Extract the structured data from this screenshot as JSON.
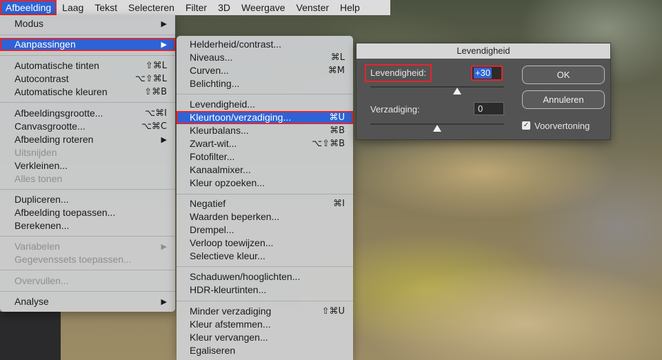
{
  "menubar": {
    "items": [
      "Afbeelding",
      "Laag",
      "Tekst",
      "Selecteren",
      "Filter",
      "3D",
      "Weergave",
      "Venster",
      "Help"
    ]
  },
  "image_menu": {
    "items": [
      {
        "label": "Modus",
        "submenu": true
      },
      {
        "label": "Aanpassingen",
        "submenu": true,
        "highlighted": true
      },
      {
        "label": "Automatische tinten",
        "shortcut": "⇧⌘L"
      },
      {
        "label": "Autocontrast",
        "shortcut": "⌥⇧⌘L"
      },
      {
        "label": "Automatische kleuren",
        "shortcut": "⇧⌘B"
      },
      {
        "label": "Afbeeldingsgrootte...",
        "shortcut": "⌥⌘I"
      },
      {
        "label": "Canvasgrootte...",
        "shortcut": "⌥⌘C"
      },
      {
        "label": "Afbeelding roteren",
        "submenu": true
      },
      {
        "label": "Uitsnijden",
        "disabled": true
      },
      {
        "label": "Verkleinen..."
      },
      {
        "label": "Alles tonen",
        "disabled": true
      },
      {
        "label": "Dupliceren..."
      },
      {
        "label": "Afbeelding toepassen..."
      },
      {
        "label": "Berekenen..."
      },
      {
        "label": "Variabelen",
        "submenu": true,
        "disabled": true
      },
      {
        "label": "Gegevenssets toepassen...",
        "disabled": true
      },
      {
        "label": "Overvullen...",
        "disabled": true
      },
      {
        "label": "Analyse",
        "submenu": true
      }
    ],
    "submenu_arrow": "▶"
  },
  "adjustments_menu": {
    "items": [
      {
        "label": "Helderheid/contrast..."
      },
      {
        "label": "Niveaus...",
        "shortcut": "⌘L"
      },
      {
        "label": "Curven...",
        "shortcut": "⌘M"
      },
      {
        "label": "Belichting..."
      },
      {
        "label": "Levendigheid..."
      },
      {
        "label": "Kleurtoon/verzadiging...",
        "shortcut": "⌘U",
        "highlighted": true
      },
      {
        "label": "Kleurbalans...",
        "shortcut": "⌘B"
      },
      {
        "label": "Zwart-wit...",
        "shortcut": "⌥⇧⌘B"
      },
      {
        "label": "Fotofilter..."
      },
      {
        "label": "Kanaalmixer..."
      },
      {
        "label": "Kleur opzoeken..."
      },
      {
        "label": "Negatief",
        "shortcut": "⌘I"
      },
      {
        "label": "Waarden beperken..."
      },
      {
        "label": "Drempel..."
      },
      {
        "label": "Verloop toewijzen..."
      },
      {
        "label": "Selectieve kleur..."
      },
      {
        "label": "Schaduwen/hooglichten..."
      },
      {
        "label": "HDR-kleurtinten..."
      },
      {
        "label": "Minder verzadiging",
        "shortcut": "⇧⌘U"
      },
      {
        "label": "Kleur afstemmen..."
      },
      {
        "label": "Kleur vervangen..."
      },
      {
        "label": "Egaliseren"
      }
    ]
  },
  "dialog": {
    "title": "Levendigheid",
    "vibrance_label": "Levendigheid:",
    "vibrance_value": "+30",
    "saturation_label": "Verzadiging:",
    "saturation_value": "0",
    "ok_label": "OK",
    "cancel_label": "Annuleren",
    "preview_label": "Voorvertoning",
    "preview_checked": true,
    "checkmark": "✓"
  },
  "colors": {
    "highlight": "#2d63d6",
    "annotation_red": "#e3262c"
  }
}
